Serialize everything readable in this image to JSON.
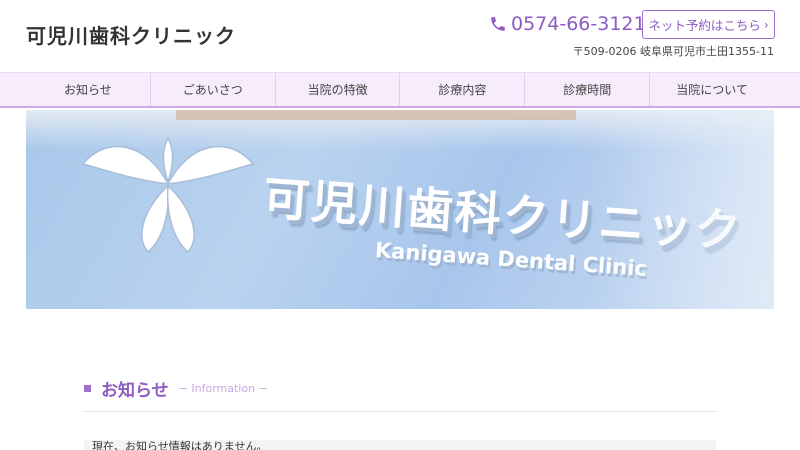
{
  "header": {
    "clinic_name": "可児川歯科クリニック",
    "phone": "0574-66-3121",
    "reserve_label": "ネット予約はこちら",
    "address": "〒509-0206 岐阜県可児市土田1355-11"
  },
  "nav": {
    "items": [
      {
        "label": "お知らせ"
      },
      {
        "label": "ごあいさつ"
      },
      {
        "label": "当院の特徴"
      },
      {
        "label": "診療内容"
      },
      {
        "label": "診療時間"
      },
      {
        "label": "当院について"
      }
    ]
  },
  "hero": {
    "sign_jp": "可児川歯科クリニック",
    "sign_en": "Kanigawa Dental Clinic"
  },
  "info": {
    "title": "お知らせ",
    "subtitle": "− Information −",
    "message": "現在、お知らせ情報はありません。"
  },
  "colors": {
    "accent": "#8e5bc1",
    "nav_bg": "#f6ecfb",
    "hero_bg": "#b4cfee"
  }
}
